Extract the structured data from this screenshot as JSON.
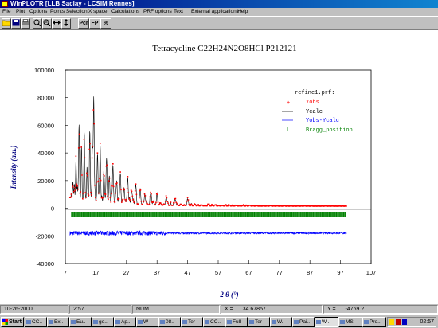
{
  "window": {
    "title": "WinPLOTR [LLB Saclay - LCSIM Rennes]"
  },
  "menu": [
    "File",
    "Plot",
    "Options",
    "Points Selection",
    "X space",
    "Calculations",
    "PRF options",
    "Text",
    "External applications",
    "Help"
  ],
  "toolbar": {
    "pcr_label": "Pcr",
    "fp_label": "FP",
    "sigma_label": "%"
  },
  "colors": {
    "obs": "#ff0000",
    "calc": "#000000",
    "diff": "#0000ff",
    "bragg": "#008000",
    "axis_label": "#000080"
  },
  "chart_data": {
    "type": "line",
    "title": "Tetracycline C22H24N2O8HCl  P212121",
    "xlabel": "2 θ (°)",
    "ylabel": "Intensity (a.u.)",
    "xlim": [
      7,
      107
    ],
    "ylim": [
      -40000,
      100000
    ],
    "xticks": [
      "7",
      "17",
      "27",
      "37",
      "47",
      "57",
      "67",
      "77",
      "87",
      "97",
      "107"
    ],
    "yticks": [
      "100000",
      "80000",
      "60000",
      "40000",
      "20000",
      "0",
      "-20000",
      "-40000"
    ],
    "legend": {
      "title": "refine1.prf:",
      "position": "top-right",
      "entries": [
        {
          "name": "Yobs",
          "color": "#ff0000",
          "marker": "point"
        },
        {
          "name": "Ycalc",
          "color": "#000000",
          "marker": "line"
        },
        {
          "name": "Yobs-Ycalc",
          "color": "#0000ff",
          "marker": "line"
        },
        {
          "name": "Bragg_position",
          "color": "#008000",
          "marker": "tick"
        }
      ]
    },
    "series": [
      {
        "name": "Yobs",
        "color": "#ff0000",
        "x": [
          9.5,
          10.5,
          11.5,
          12.3,
          13.2,
          14.1,
          15.0,
          15.9,
          16.3,
          17.5,
          18.4,
          19.6,
          20.5,
          21.4,
          22.6,
          23.8,
          25.0,
          26.2,
          27.4,
          28.6,
          30.0,
          31.5,
          33.0,
          35.0,
          37.0,
          40.0,
          43.0,
          47.0
        ],
        "y": [
          20000,
          38000,
          63000,
          41000,
          52000,
          31000,
          58000,
          41000,
          82000,
          38000,
          47000,
          29000,
          37000,
          24000,
          28000,
          21000,
          26000,
          16000,
          23000,
          14000,
          17000,
          13000,
          11000,
          12000,
          10000,
          9000,
          7000,
          6000
        ]
      },
      {
        "name": "Ycalc",
        "color": "#000000",
        "x": [
          9.5,
          10.5,
          11.5,
          12.3,
          13.2,
          14.1,
          15.0,
          15.9,
          16.3,
          17.5,
          18.4,
          19.6,
          20.5,
          21.4,
          22.6,
          23.8,
          25.0,
          26.2,
          27.4,
          28.6,
          30.0,
          31.5,
          33.0,
          35.0,
          37.0,
          40.0,
          43.0,
          47.0
        ],
        "y": [
          19000,
          36000,
          60000,
          40000,
          50000,
          30000,
          56000,
          40000,
          80000,
          37000,
          45000,
          28000,
          36000,
          23000,
          27000,
          20000,
          25000,
          15000,
          22000,
          13000,
          16000,
          12000,
          10000,
          11000,
          9000,
          8000,
          6000,
          5000
        ]
      },
      {
        "name": "Yobs-Ycalc",
        "color": "#0000ff",
        "offset": -18000
      }
    ],
    "bragg_range": [
      9,
      99
    ]
  },
  "status": {
    "date": "10-26-2000",
    "time": "2:57",
    "num": "NUM",
    "x_label": "X =",
    "x_value": "34.67857",
    "y_label": "Y =",
    "y_value": "-4769.2"
  },
  "taskbar": {
    "start_label": "Start",
    "tasks": [
      "CC..",
      "Ex..",
      "Eu..",
      "go..",
      "Ap..",
      "W",
      "08..",
      "Ter",
      "CC..",
      "Full",
      "Ter",
      "W..",
      "Pai..",
      "W...",
      "MS",
      "Pro.."
    ],
    "clock": "02:57"
  }
}
